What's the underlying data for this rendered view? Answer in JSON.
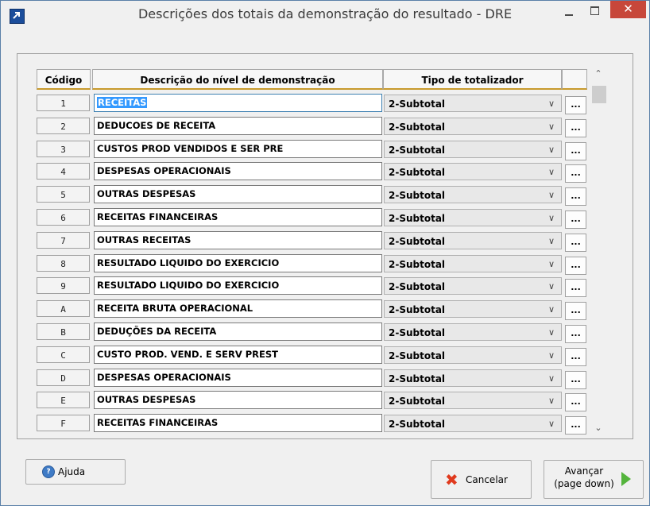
{
  "window": {
    "title": "Descrições dos totais da demonstração do resultado - DRE",
    "close_glyph": "✕"
  },
  "grid": {
    "columns": {
      "code": "Código",
      "description": "Descrição do nível de demonstração",
      "type": "Tipo de totalizador",
      "action": ""
    },
    "rows": [
      {
        "code": "1",
        "description": "RECEITAS",
        "type": "2-Subtotal",
        "action": "..."
      },
      {
        "code": "2",
        "description": "DEDUCOES DE RECEITA",
        "type": "2-Subtotal",
        "action": "..."
      },
      {
        "code": "3",
        "description": "CUSTOS PROD VENDIDOS E SER PRE",
        "type": "2-Subtotal",
        "action": "..."
      },
      {
        "code": "4",
        "description": "DESPESAS OPERACIONAIS",
        "type": "2-Subtotal",
        "action": "..."
      },
      {
        "code": "5",
        "description": "OUTRAS DESPESAS",
        "type": "2-Subtotal",
        "action": "..."
      },
      {
        "code": "6",
        "description": "RECEITAS FINANCEIRAS",
        "type": "2-Subtotal",
        "action": "..."
      },
      {
        "code": "7",
        "description": "OUTRAS RECEITAS",
        "type": "2-Subtotal",
        "action": "..."
      },
      {
        "code": "8",
        "description": "RESULTADO LIQUIDO DO EXERCICIO",
        "type": "2-Subtotal",
        "action": "..."
      },
      {
        "code": "9",
        "description": "RESULTADO LIQUIDO DO EXERCICIO",
        "type": "2-Subtotal",
        "action": "..."
      },
      {
        "code": "A",
        "description": "RECEITA BRUTA OPERACIONAL",
        "type": "2-Subtotal",
        "action": "..."
      },
      {
        "code": "B",
        "description": "DEDUÇÕES DA RECEITA",
        "type": "2-Subtotal",
        "action": "..."
      },
      {
        "code": "C",
        "description": "CUSTO PROD. VEND. E SERV PREST",
        "type": "2-Subtotal",
        "action": "..."
      },
      {
        "code": "D",
        "description": "DESPESAS OPERACIONAIS",
        "type": "2-Subtotal",
        "action": "..."
      },
      {
        "code": "E",
        "description": "OUTRAS DESPESAS",
        "type": "2-Subtotal",
        "action": "..."
      },
      {
        "code": "F",
        "description": "RECEITAS FINANCEIRAS",
        "type": "2-Subtotal",
        "action": "..."
      }
    ],
    "selected_row": 0
  },
  "buttons": {
    "help": "Ajuda",
    "cancel": "Cancelar",
    "next_line1": "Avançar",
    "next_line2": "(page down)"
  },
  "icons": {
    "app": "app-arrow-icon",
    "help": "help-icon",
    "cancel": "red-x-icon",
    "next": "green-arrow-icon"
  }
}
